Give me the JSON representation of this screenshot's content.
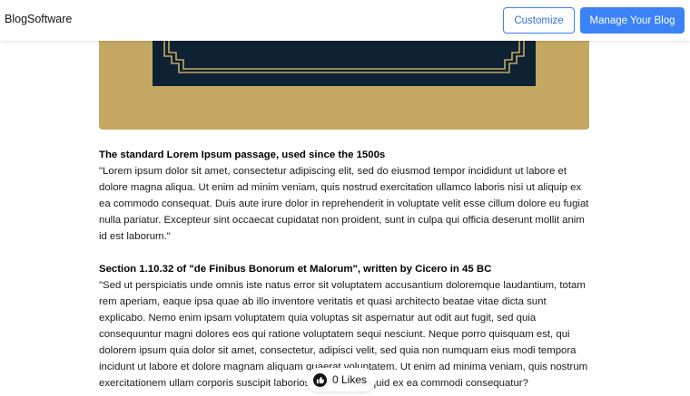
{
  "header": {
    "brand": "BlogSoftware",
    "customize_label": "Customize",
    "manage_label": "Manage Your Blog",
    "accent_color": "#3b82f6"
  },
  "hero": {
    "background_color": "#c4a862",
    "panel_color": "#0d2233",
    "ornament_color": "#c4a862"
  },
  "article": {
    "sections": [
      {
        "heading": "The standard Lorem Ipsum passage, used since the 1500s",
        "body": "\"Lorem ipsum dolor sit amet, consectetur adipiscing elit, sed do eiusmod tempor incididunt ut labore et dolore magna aliqua. Ut enim ad minim veniam, quis nostrud exercitation ullamco laboris nisi ut aliquip ex ea commodo consequat. Duis aute irure dolor in reprehenderit in voluptate velit esse cillum dolore eu fugiat nulla pariatur. Excepteur sint occaecat cupidatat non proident, sunt in culpa qui officia deserunt mollit anim id est laborum.\""
      },
      {
        "heading": "Section 1.10.32 of \"de Finibus Bonorum et Malorum\", written by Cicero in 45 BC",
        "body": "\"Sed ut perspiciatis unde omnis iste natus error sit voluptatem accusantium doloremque laudantium, totam rem aperiam, eaque ipsa quae ab illo inventore veritatis et quasi architecto beatae vitae dicta sunt explicabo. Nemo enim ipsam voluptatem quia voluptas sit aspernatur aut odit aut fugit, sed quia consequuntur magni dolores eos qui ratione voluptatem sequi nesciunt. Neque porro quisquam est, qui dolorem ipsum quia dolor sit amet, consectetur, adipisci velit, sed quia non numquam eius modi tempora incidunt ut labore et dolore magnam aliquam quaerat voluptatem. Ut enim ad minima veniam, quis nostrum exercitationem ullam corporis suscipit laboriosam, nisi ut aliquid ex ea commodi consequatur?"
      }
    ]
  },
  "likes": {
    "label": "0 Likes",
    "icon": "like-icon"
  }
}
